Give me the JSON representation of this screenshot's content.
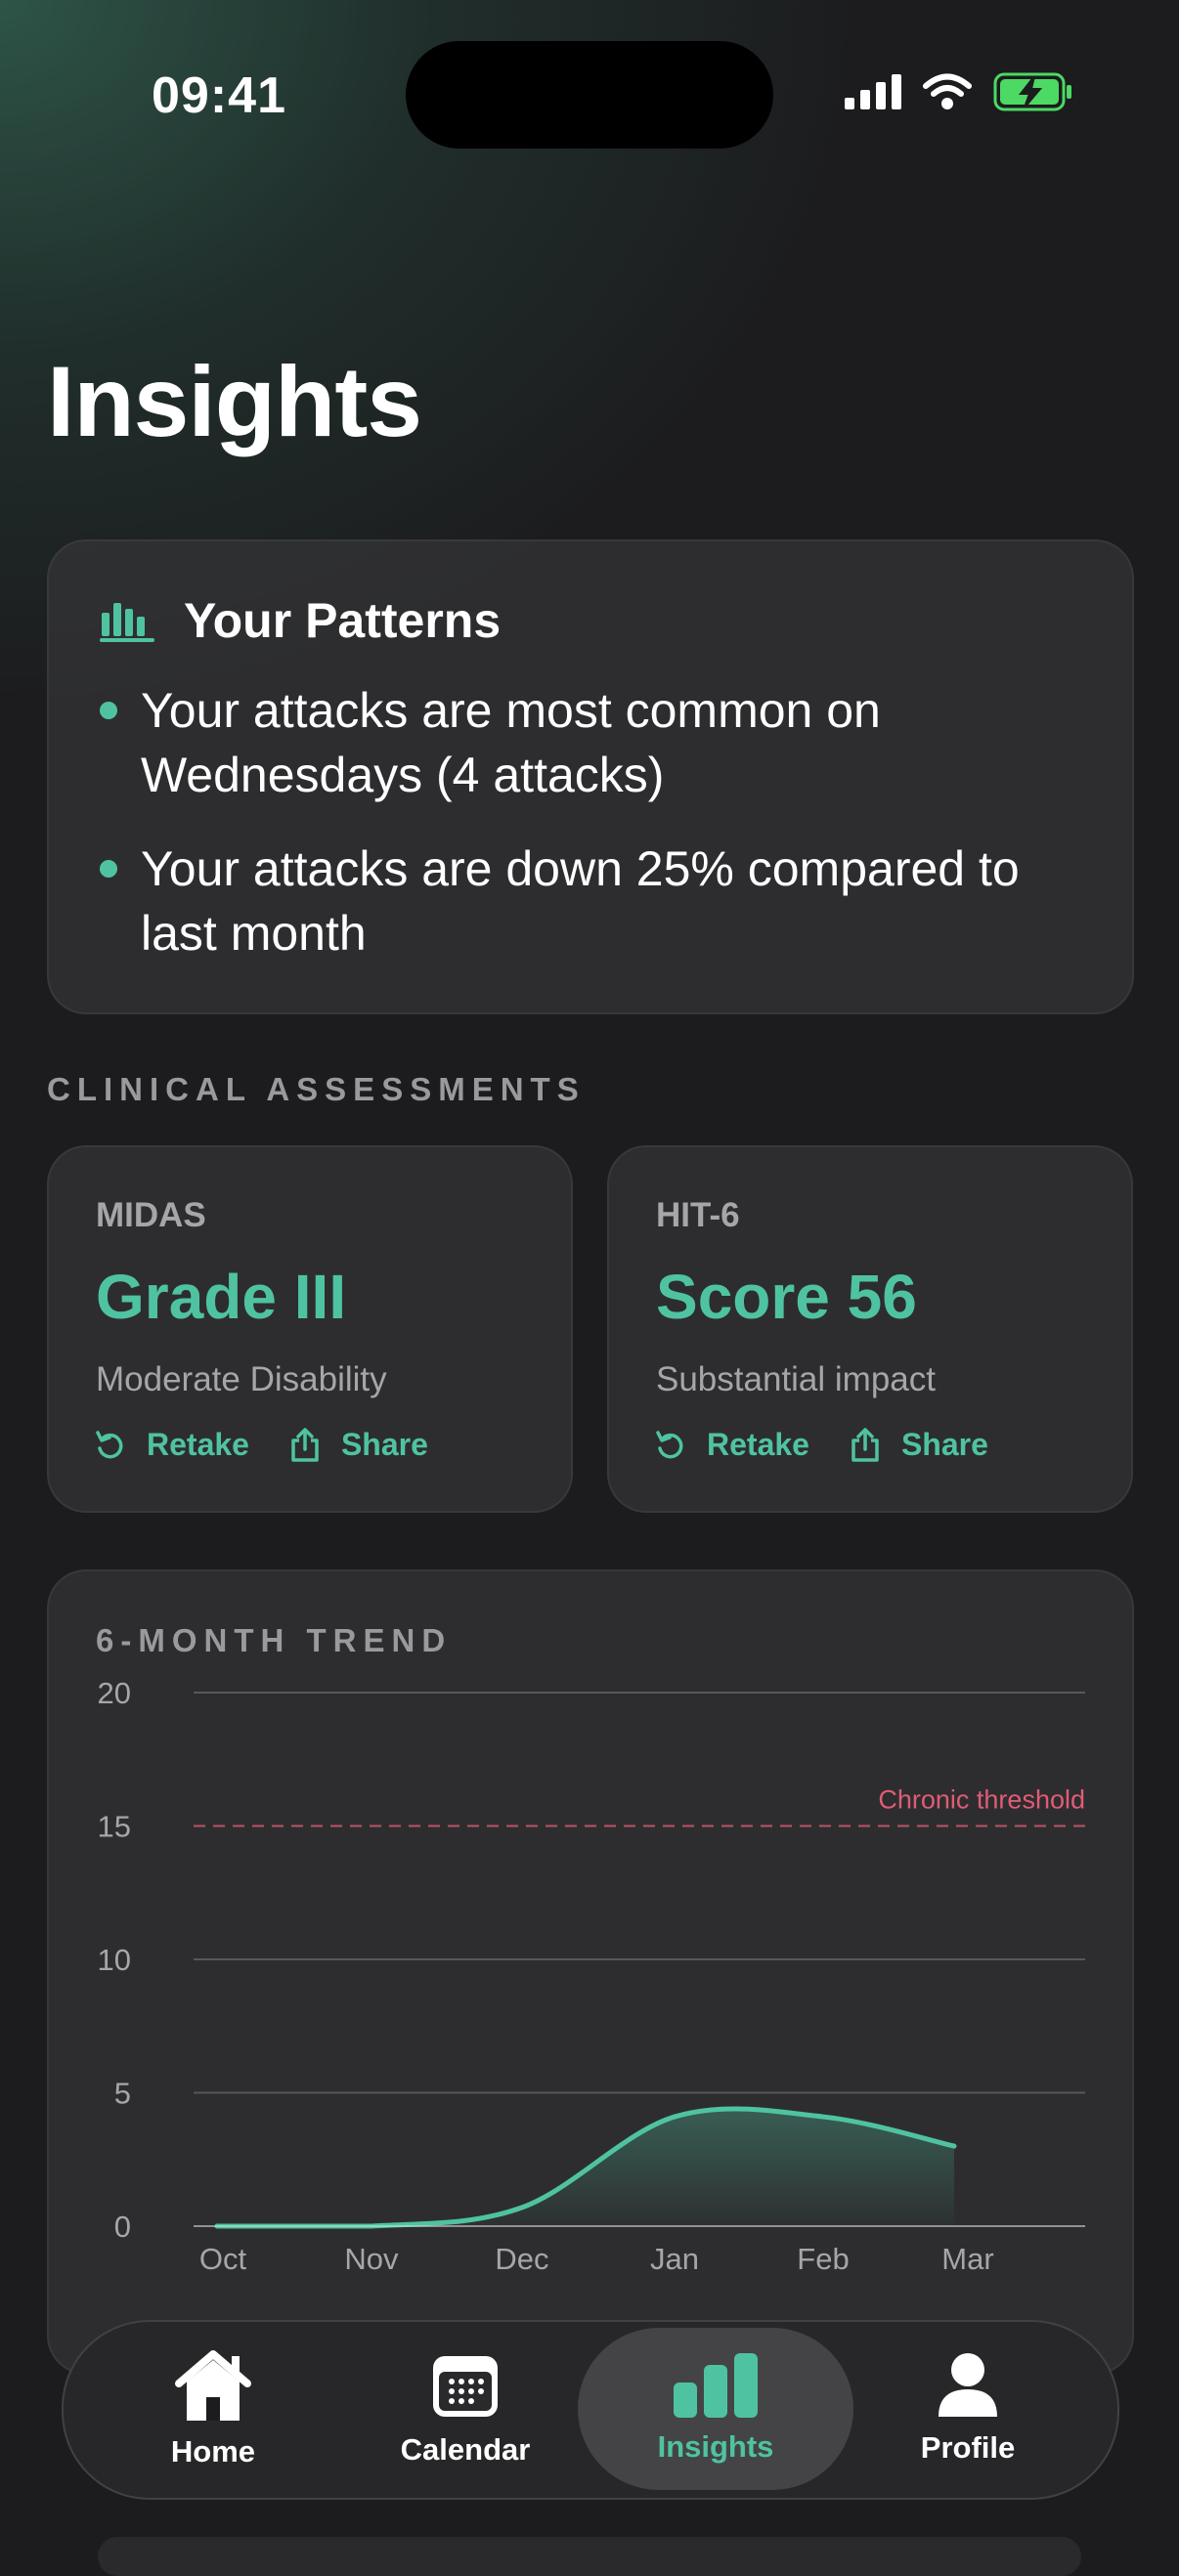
{
  "status": {
    "time": "09:41"
  },
  "page": {
    "title": "Insights"
  },
  "patterns": {
    "title": "Your Patterns",
    "icon": "bar-chart-icon",
    "items": [
      "Your attacks are most common on Wednesdays (4 attacks)",
      "Your attacks are down 25% compared to last month"
    ]
  },
  "clinical": {
    "section_label": "CLINICAL ASSESSMENTS",
    "midas": {
      "name": "MIDAS",
      "value": "Grade III",
      "desc": "Moderate Disability",
      "retake": "Retake",
      "share": "Share"
    },
    "hit6": {
      "name": "HIT-6",
      "value": "Score 56",
      "desc": "Substantial impact",
      "retake": "Retake",
      "share": "Share"
    }
  },
  "trend": {
    "label": "6-MONTH TREND"
  },
  "chart_data": {
    "type": "area",
    "title": "6-MONTH TREND",
    "categories": [
      "Oct",
      "Nov",
      "Dec",
      "Jan",
      "Feb",
      "Mar"
    ],
    "series": [
      {
        "values": [
          0,
          0,
          0.7,
          4.1,
          4.1,
          3.0
        ]
      }
    ],
    "ylim": [
      0,
      20
    ],
    "yticks": [
      0,
      5,
      10,
      15,
      20
    ],
    "threshold": {
      "value": 15,
      "label": "Chronic threshold",
      "color": "#e05c75"
    },
    "grid": true,
    "color": "#4fc3a1"
  },
  "nav": {
    "items": [
      {
        "label": "Home",
        "icon": "home-icon"
      },
      {
        "label": "Calendar",
        "icon": "calendar-icon"
      },
      {
        "label": "Insights",
        "icon": "insights-icon",
        "active": true
      },
      {
        "label": "Profile",
        "icon": "profile-icon"
      }
    ]
  },
  "colors": {
    "accent": "#4fc3a1",
    "background": "#1c1c1e",
    "card": "#343436",
    "threshold": "#e05c75"
  }
}
